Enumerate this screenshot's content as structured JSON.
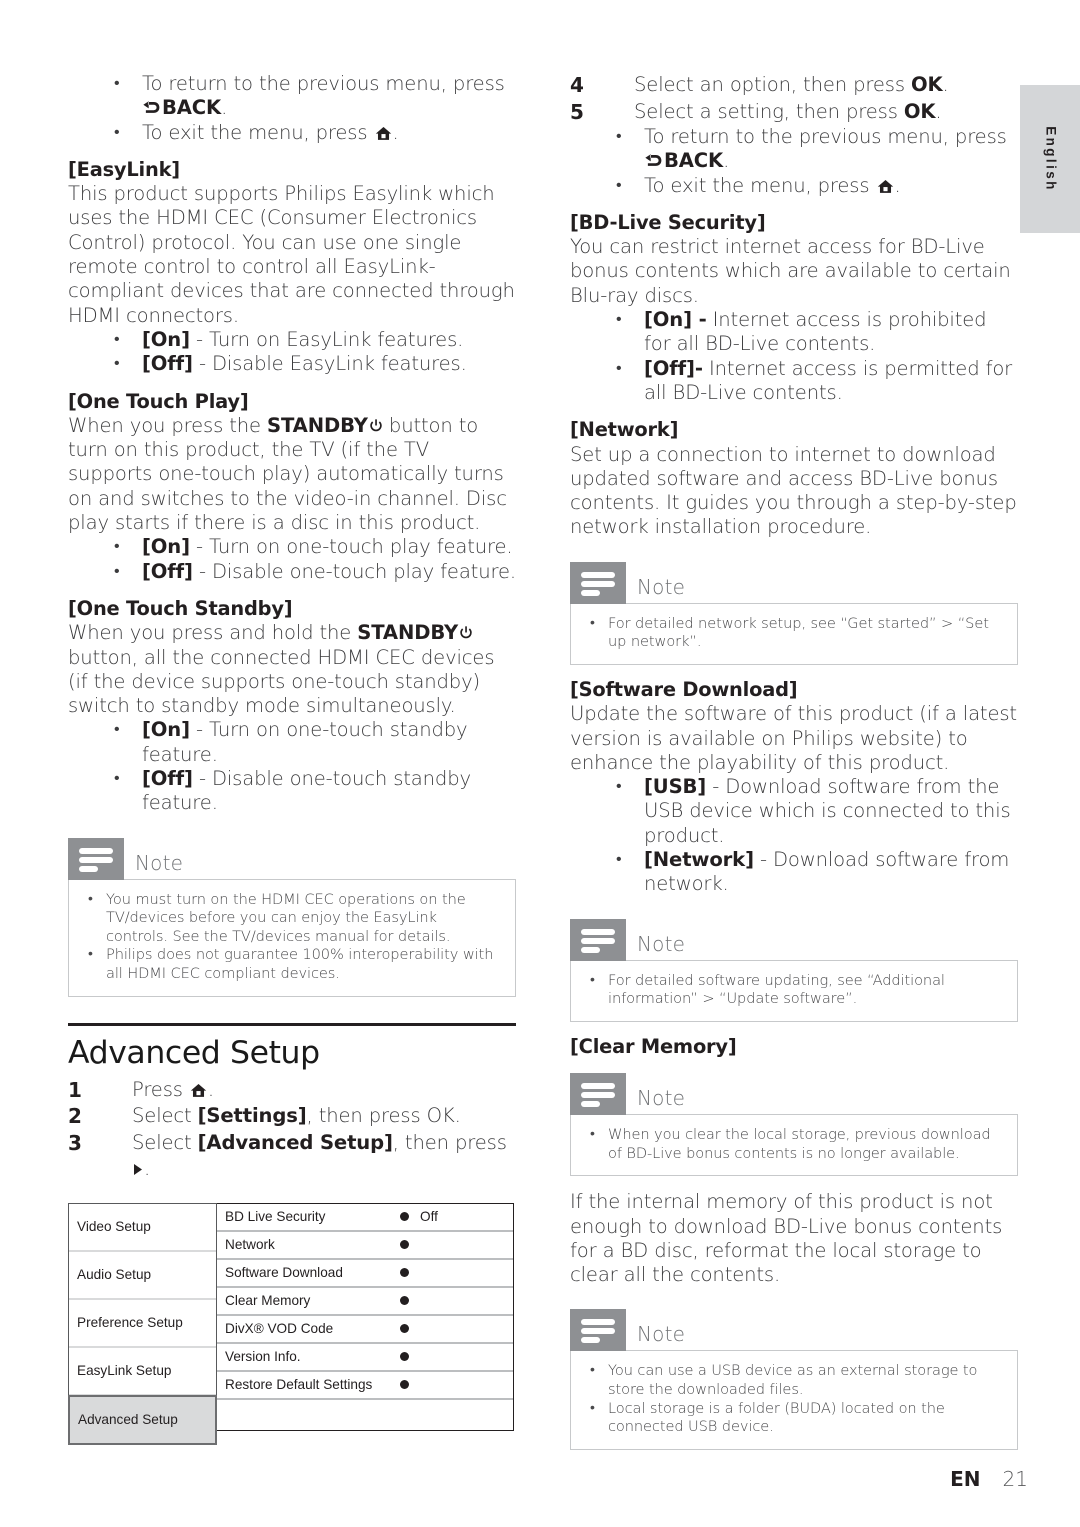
{
  "page": {
    "language_tab": "English",
    "footer": {
      "locale": "EN",
      "number": "21"
    }
  },
  "left_column": {
    "top_bullets": [
      {
        "prefix": "To return to the previous menu, press ",
        "icon": "back-icon",
        "emphasis": "BACK",
        "suffix": "."
      },
      {
        "prefix": "To exit the menu, press ",
        "icon": "home-icon",
        "emphasis": "",
        "suffix": "."
      }
    ],
    "easylink": {
      "heading": "[EasyLink]",
      "body": "This product supports Philips Easylink which uses the HDMI CEC (Consumer Electronics Control) protocol. You can use one single remote control to control all EasyLink-compliant devices that are connected through HDMI connectors.",
      "options": [
        {
          "key": "[On]",
          "text": " - Turn on EasyLink features."
        },
        {
          "key": "[Off]",
          "text": " - Disable EasyLink features."
        }
      ]
    },
    "one_touch_play": {
      "heading": "[One Touch Play]",
      "body_part1": "When you press the ",
      "body_bold": "STANDBY",
      "body_part2": " button to turn on this product, the TV (if the TV supports one-touch play) automatically turns on and switches to the video-in channel. Disc play starts if there is a disc in this product.",
      "options": [
        {
          "key": "[On]",
          "text": " - Turn on one-touch play feature."
        },
        {
          "key": "[Off]",
          "text": " - Disable one-touch play feature."
        }
      ]
    },
    "one_touch_standby": {
      "heading": "[One Touch Standby]",
      "body_part1": "When you press and hold the ",
      "body_bold": "STANDBY",
      "body_part2": " button, all the connected HDMI CEC devices (if the device supports one-touch standby) switch to standby mode simultaneously.",
      "options": [
        {
          "key": "[On]",
          "text": " - Turn on one-touch standby feature."
        },
        {
          "key": "[Off]",
          "text": " - Disable one-touch standby feature."
        }
      ]
    },
    "note_easylink": {
      "title": "Note",
      "items": [
        "You must turn on the HDMI CEC operations on the TV/devices before you can enjoy the EasyLink controls. See the TV/devices manual for details.",
        "Philips does not guarantee 100% interoperability with all HDMI CEC compliant devices."
      ]
    },
    "advanced_setup": {
      "title": "Advanced Setup",
      "steps": [
        {
          "num": "1",
          "prefix": "Press ",
          "icon": "home-icon",
          "bold": "",
          "suffix": "."
        },
        {
          "num": "2",
          "prefix": "Select ",
          "icon": "",
          "bold": "[Settings]",
          "suffix": ", then press OK."
        },
        {
          "num": "3",
          "prefix": "Select ",
          "icon": "",
          "bold": "[Advanced Setup]",
          "suffix": ", then press "
        }
      ]
    },
    "osd_menu": {
      "left_items": [
        {
          "label": "Video Setup",
          "selected": false
        },
        {
          "label": "Audio Setup",
          "selected": false
        },
        {
          "label": "Preference Setup",
          "selected": false
        },
        {
          "label": "EasyLink Setup",
          "selected": false
        },
        {
          "label": "Advanced Setup",
          "selected": true
        }
      ],
      "right_rows": [
        {
          "label": "BD Live Security",
          "value": "Off"
        },
        {
          "label": "Network",
          "value": ""
        },
        {
          "label": "Software Download",
          "value": ""
        },
        {
          "label": "Clear Memory",
          "value": ""
        },
        {
          "label": "DivX® VOD Code",
          "value": ""
        },
        {
          "label": "Version Info.",
          "value": ""
        },
        {
          "label": "Restore Default Settings",
          "value": ""
        }
      ]
    }
  },
  "right_column": {
    "steps": [
      {
        "num": "4",
        "text": "Select an option, then press ",
        "bold": "OK",
        "suffix": "."
      },
      {
        "num": "5",
        "text": "Select a setting, then press ",
        "bold": "OK",
        "suffix": "."
      }
    ],
    "step_bullets": [
      {
        "prefix": "To return to the previous menu, press ",
        "icon": "back-icon",
        "emphasis": "BACK",
        "suffix": "."
      },
      {
        "prefix": "To exit the menu, press ",
        "icon": "home-icon",
        "emphasis": "",
        "suffix": "."
      }
    ],
    "bd_live_security": {
      "heading": "[BD-Live Security]",
      "body": "You can restrict internet access for BD-Live bonus contents which are available to certain Blu-ray discs.",
      "options": [
        {
          "key": "[On] -",
          "text": " Internet access is prohibited for all BD-Live contents."
        },
        {
          "key": "[Off]-",
          "text": " Internet access is permitted for all BD-Live contents."
        }
      ]
    },
    "network": {
      "heading": "[Network]",
      "body": "Set up a connection to internet to download updated software and access BD-Live bonus contents. It guides you through a step-by-step network installation procedure."
    },
    "note_network": {
      "title": "Note",
      "items": [
        "For detailed network setup, see “Get started” > “Set up network”."
      ]
    },
    "software_download": {
      "heading": "[Software Download]",
      "body": "Update the software of this product (if a latest version is available on Philips website) to enhance the playability of this product.",
      "options": [
        {
          "key": "[USB]",
          "text": " - Download software from the USB device which is connected to this product."
        },
        {
          "key": "[Network]",
          "text": " - Download software from network."
        }
      ]
    },
    "note_software": {
      "title": "Note",
      "items": [
        "For detailed software updating, see “Additional information” > “Update software”."
      ]
    },
    "clear_memory": {
      "heading": "[Clear Memory]",
      "trailing_para": "If the internal memory of this product is not enough to download BD-Live bonus contents for a BD disc, reformat the local storage to clear all the contents."
    },
    "note_clear_memory": {
      "title": "Note",
      "items": [
        "When you clear the local storage, previous download of BD-Live bonus contents is no longer available."
      ]
    },
    "note_usb_storage": {
      "title": "Note",
      "items": [
        "You can use a USB device as an external storage to store the downloaded files.",
        "Local storage is a folder (BUDA) located on the connected USB device."
      ]
    }
  },
  "colors": {
    "note_icon_gray": "#8e9093",
    "note_border": "#c7c9cb",
    "tab_gray": "#d4d6d8",
    "text": "#3b3b3d",
    "heading": "#231f20"
  }
}
